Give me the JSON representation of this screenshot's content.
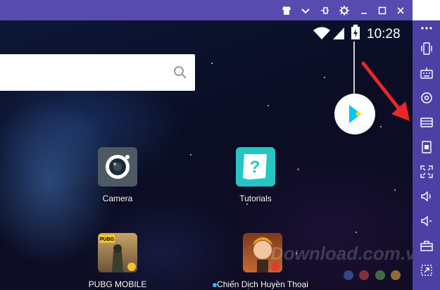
{
  "titlebar": {
    "buttons": [
      "shirt-icon",
      "chevron-down-icon",
      "pin-icon",
      "gear-icon",
      "minimize-icon",
      "maximize-icon",
      "close-icon"
    ]
  },
  "status_bar": {
    "time": "10:28"
  },
  "search": {
    "placeholder": ""
  },
  "apps": [
    {
      "label": "Camera"
    },
    {
      "label": "Tutorials"
    },
    {
      "label": "PUBG MOBILE"
    },
    {
      "label": "Chiến Dịch Huyền Thoại"
    }
  ],
  "watermark": "Download.com.vn",
  "sidebar": {
    "items": [
      "more-icon",
      "shake-icon",
      "keyboard-icon",
      "location-icon",
      "screen-icon",
      "apk-icon",
      "fullscreen-icon",
      "volume-up-icon",
      "volume-down-icon",
      "toolbox-icon",
      "multi-instance-icon"
    ]
  },
  "colors": {
    "titlebar": "#574bb0",
    "sidebar": "#4d40a5",
    "arrow": "#e8272a"
  }
}
